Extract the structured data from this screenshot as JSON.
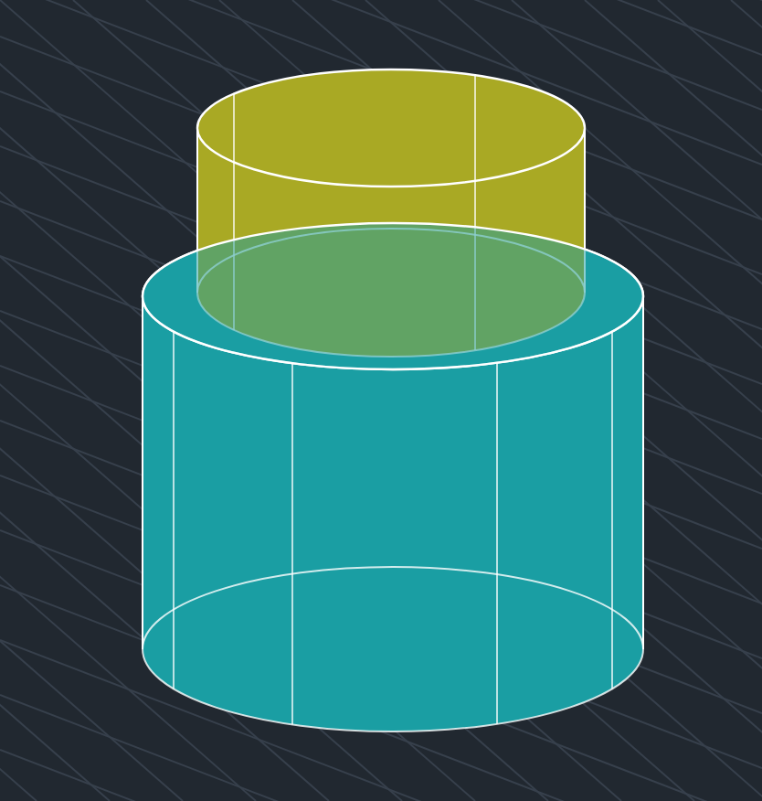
{
  "viewport": {
    "solids": [
      {
        "kind": "cylinder",
        "color": "#1a9ea3"
      },
      {
        "kind": "cylinder",
        "color": "#a9a924"
      }
    ]
  }
}
